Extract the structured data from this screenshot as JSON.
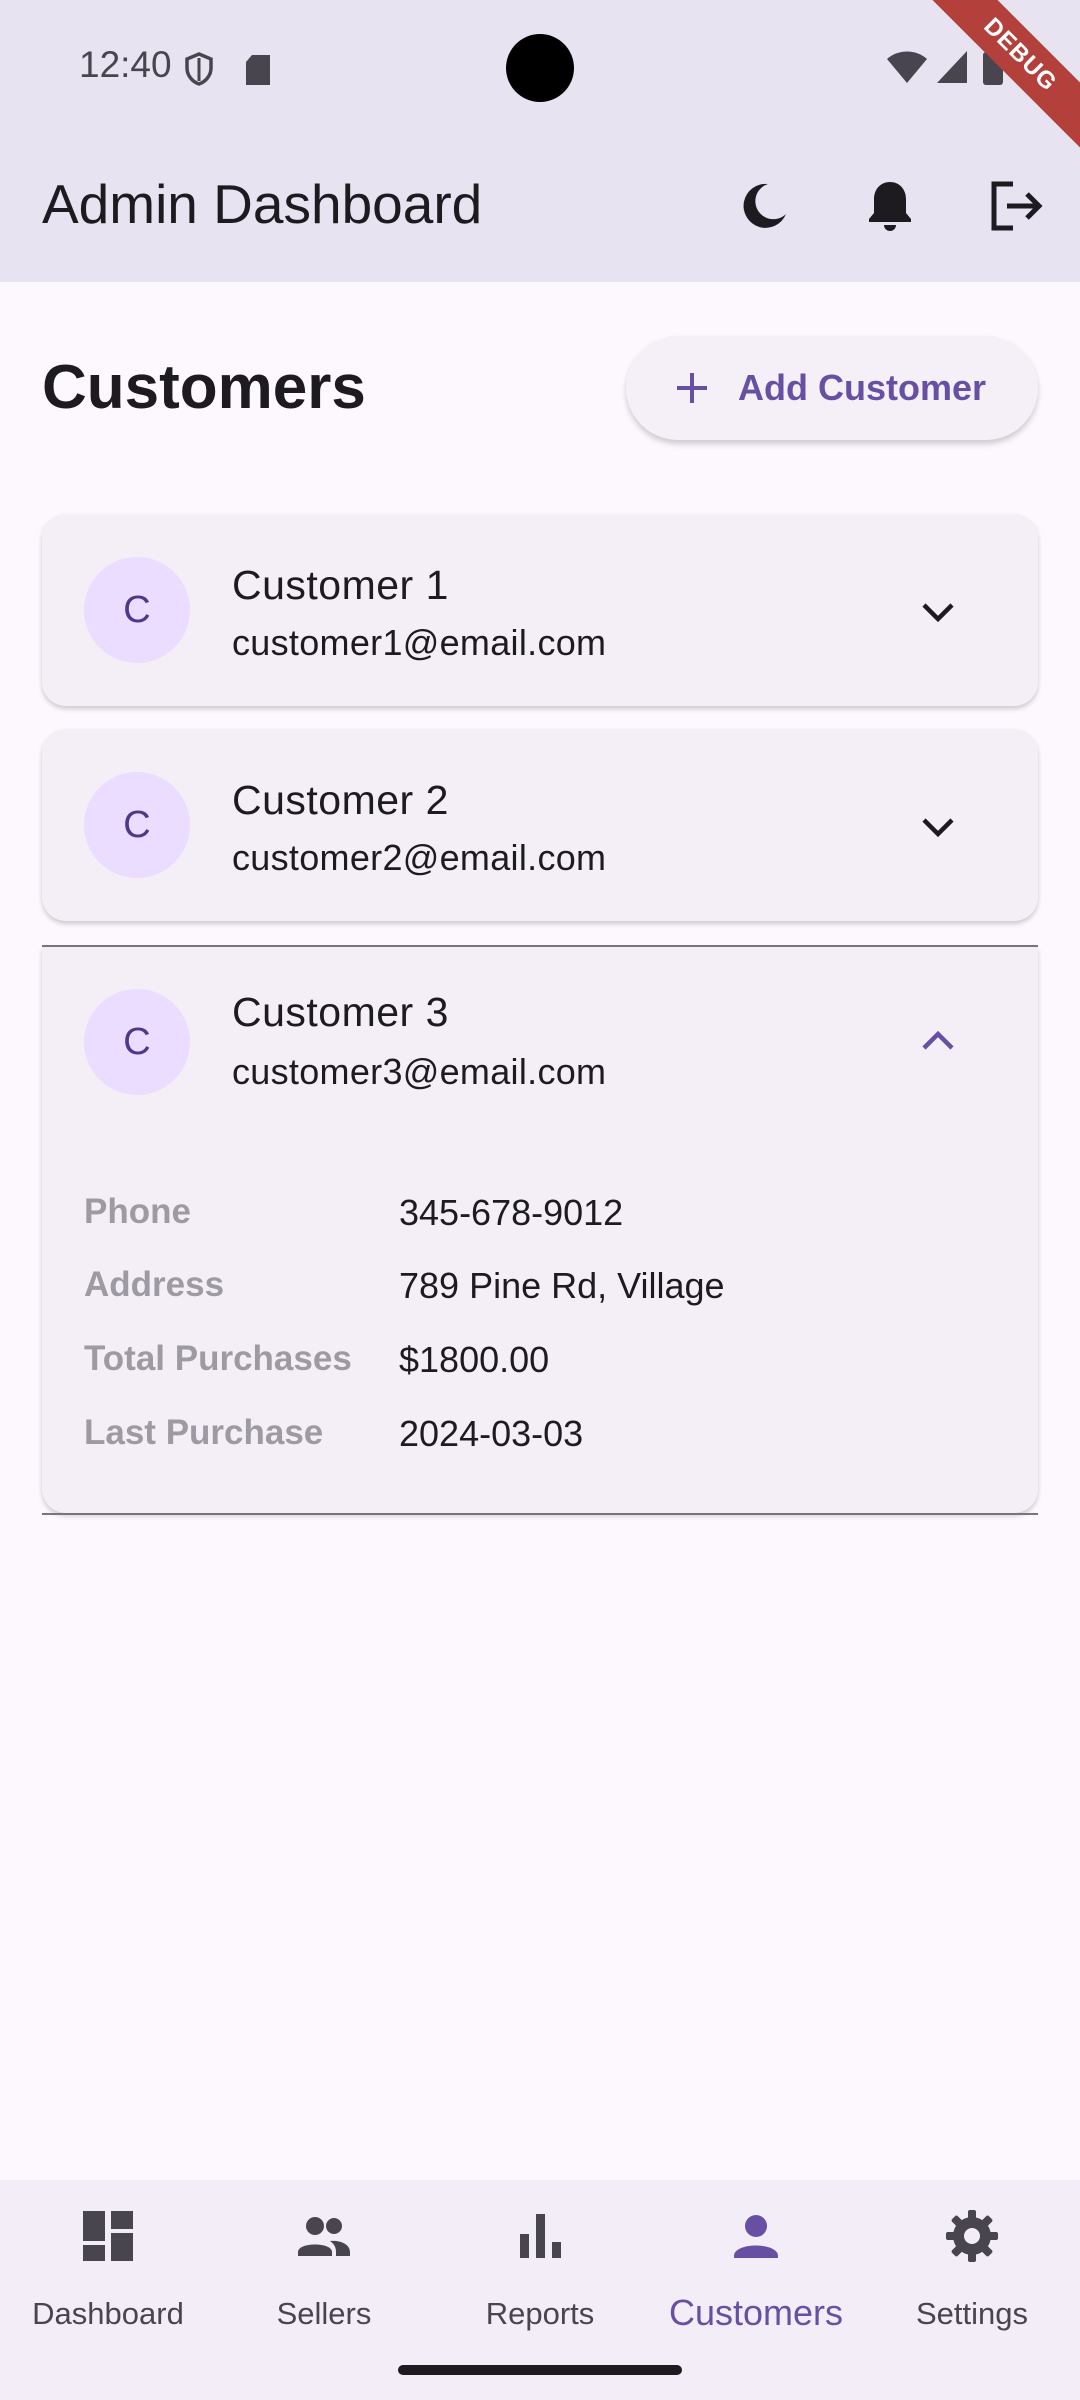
{
  "status_bar": {
    "time": "12:40",
    "debug_banner": "DEBUG"
  },
  "app_bar": {
    "title": "Admin Dashboard",
    "actions": [
      "dark-mode-icon",
      "notifications-icon",
      "logout-icon"
    ]
  },
  "page": {
    "title": "Customers",
    "add_button_label": "Add Customer"
  },
  "customers": [
    {
      "initial": "C",
      "name": "Customer 1",
      "email": "customer1@email.com",
      "expanded": false
    },
    {
      "initial": "C",
      "name": "Customer 2",
      "email": "customer2@email.com",
      "expanded": false
    },
    {
      "initial": "C",
      "name": "Customer 3",
      "email": "customer3@email.com",
      "expanded": true,
      "details": [
        {
          "label": "Phone",
          "value": "345-678-9012"
        },
        {
          "label": "Address",
          "value": "789 Pine Rd, Village"
        },
        {
          "label": "Total Purchases",
          "value": "$1800.00"
        },
        {
          "label": "Last Purchase",
          "value": "2024-03-03"
        }
      ]
    }
  ],
  "bottom_nav": {
    "items": [
      {
        "label": "Dashboard",
        "icon": "dashboard-icon"
      },
      {
        "label": "Sellers",
        "icon": "people-icon"
      },
      {
        "label": "Reports",
        "icon": "bar-chart-icon"
      },
      {
        "label": "Customers",
        "icon": "person-icon",
        "active": true
      },
      {
        "label": "Settings",
        "icon": "gear-icon"
      }
    ]
  },
  "colors": {
    "primary": "#6750a4",
    "app_bar_bg": "#e8e3f0",
    "card_bg": "#f4eff6",
    "avatar_bg": "#eaddff"
  }
}
